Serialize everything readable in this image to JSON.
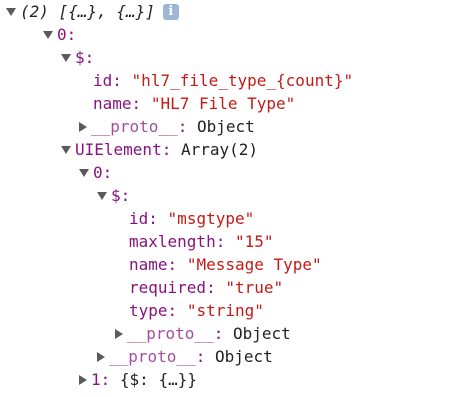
{
  "tree": {
    "root": {
      "summary": "(2) [{…}, {…}]",
      "info_badge": "i"
    },
    "item0": {
      "key": "0:"
    },
    "item0_dollar": {
      "key": "$:"
    },
    "item0_id": {
      "key": "id:",
      "value": "\"hl7_file_type_{count}\""
    },
    "item0_name": {
      "key": "name:",
      "value": "\"HL7 File Type\""
    },
    "item0_dollar_proto": {
      "key": "__proto__",
      "colon": ":",
      "value": "Object"
    },
    "uielement": {
      "key": "UIElement:",
      "value": "Array(2)"
    },
    "ui0": {
      "key": "0:"
    },
    "ui0_dollar": {
      "key": "$:"
    },
    "ui0_id": {
      "key": "id:",
      "value": "\"msgtype\""
    },
    "ui0_maxlength": {
      "key": "maxlength:",
      "value": "\"15\""
    },
    "ui0_name": {
      "key": "name:",
      "value": "\"Message Type\""
    },
    "ui0_required": {
      "key": "required:",
      "value": "\"true\""
    },
    "ui0_type": {
      "key": "type:",
      "value": "\"string\""
    },
    "ui0_dollar_proto": {
      "key": "__proto__",
      "colon": ":",
      "value": "Object"
    },
    "ui0_proto": {
      "key": "__proto__",
      "colon": ":",
      "value": "Object"
    },
    "ui1": {
      "key": "1:",
      "value": "{$: {…}}"
    }
  },
  "colors": {
    "key": "#881280",
    "string": "#c41a16",
    "text": "#222222",
    "triangle": "#5a5a5a",
    "info_badge": "#9fb5d6"
  },
  "icons": {
    "expanded": "triangle-down-icon",
    "collapsed": "triangle-right-icon",
    "info": "info-icon"
  }
}
